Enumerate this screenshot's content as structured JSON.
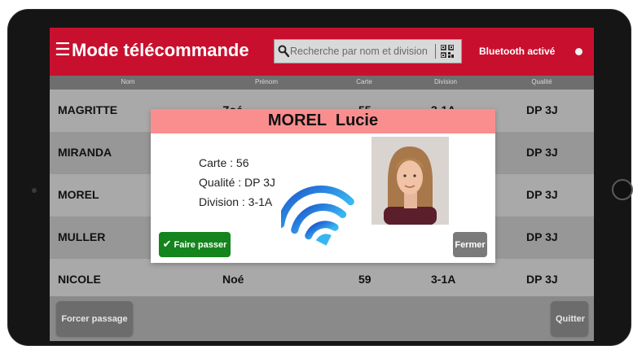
{
  "header": {
    "menu_icon": "menu-icon",
    "title": "Mode télécommande",
    "search_placeholder": "Recherche par nom et division",
    "bluetooth_status": "Bluetooth activé"
  },
  "columns": [
    "Nom",
    "Prénom",
    "Carte",
    "Division",
    "Qualité"
  ],
  "rows": [
    {
      "nom": "MAGRITTE",
      "prenom": "Zoé",
      "carte": "55",
      "division": "3-1A",
      "qualite": "DP 3J"
    },
    {
      "nom": "MIRANDA",
      "prenom": "",
      "carte": "",
      "division": "",
      "qualite": "DP 3J"
    },
    {
      "nom": "MOREL",
      "prenom": "",
      "carte": "",
      "division": "",
      "qualite": "DP 3J"
    },
    {
      "nom": "MULLER",
      "prenom": "",
      "carte": "",
      "division": "",
      "qualite": "DP 3J"
    },
    {
      "nom": "NICOLE",
      "prenom": "Noé",
      "carte": "59",
      "division": "3-1A",
      "qualite": "DP 3J"
    }
  ],
  "modal": {
    "title": "MOREL  Lucie",
    "carte": "Carte : 56",
    "qualite": "Qualité : DP 3J",
    "division": "Division : 3-1A",
    "pass_label": "Faire passer",
    "close_label": "Fermer"
  },
  "footer": {
    "force_label": "Forcer passage",
    "quit_label": "Quitter"
  },
  "colors": {
    "header": "#c8102e",
    "modal_header": "#fa8e8e",
    "pass_button": "#14841c",
    "wifi_blue": "#2a8de0"
  }
}
